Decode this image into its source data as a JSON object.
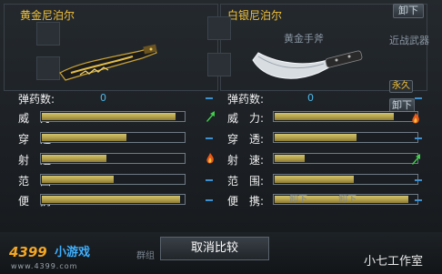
{
  "left_weapon": {
    "name": "黄金尼泊尔"
  },
  "right_weapon": {
    "name": "白银尼泊尔"
  },
  "right_top_button": "卸下",
  "background_items": {
    "axe_name": "黄金手斧",
    "category": "近战武器",
    "durability_badge": "永久",
    "unequip_button": "卸下",
    "bottom_left_label": "群组",
    "slot_labels": [
      "卸下",
      "卸下"
    ]
  },
  "stats": [
    {
      "key": "ammo",
      "label": "弹药数:",
      "left_value": "0",
      "right_value": "0",
      "compare": "equal"
    },
    {
      "key": "power",
      "label": "威　力:",
      "left_fill": 0.93,
      "right_fill": 0.83,
      "compare": "better"
    },
    {
      "key": "penetration",
      "label": "穿　透:",
      "left_fill": 0.59,
      "right_fill": 0.57,
      "compare": "equal"
    },
    {
      "key": "rate",
      "label": "射　速:",
      "left_fill": 0.45,
      "right_fill": 0.21,
      "compare": "better"
    },
    {
      "key": "range",
      "label": "范　围:",
      "left_fill": 0.5,
      "right_fill": 0.55,
      "compare": "equal"
    },
    {
      "key": "handling",
      "label": "便　携:",
      "left_fill": 0.96,
      "right_fill": 0.93,
      "compare": "equal"
    }
  ],
  "right_compare_icons": [
    "flame-down",
    "arrow-up"
  ],
  "cancel_button": "取消比较",
  "logo": {
    "brand": "4399",
    "game": "小游戏",
    "url": "www.4399.com"
  },
  "watermark": "小七工作室",
  "colors": {
    "gold_name": "#f2c23a",
    "bar_fill": "#c8b55a",
    "ammo_value": "#4fb7e8",
    "dash": "#3d8fd0"
  }
}
